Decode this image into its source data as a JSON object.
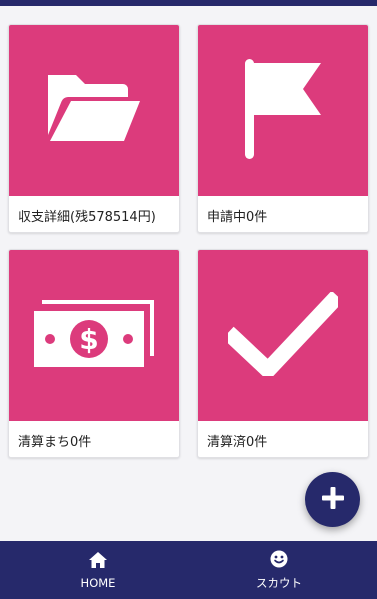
{
  "colors": {
    "primary": "#26296b",
    "tile": "#dc3b7c",
    "background": "#f4f4f7"
  },
  "cards": [
    {
      "label": "収支詳細(残578514円)",
      "icon": "folder-open-icon"
    },
    {
      "label": "申請中0件",
      "icon": "flag-icon"
    },
    {
      "label": "清算まち0件",
      "icon": "money-bill-icon"
    },
    {
      "label": "清算済0件",
      "icon": "check-icon"
    }
  ],
  "fab": {
    "icon": "plus-icon"
  },
  "bottom_nav": [
    {
      "label": "HOME",
      "icon": "home-icon"
    },
    {
      "label": "スカウト",
      "icon": "smile-icon"
    }
  ]
}
